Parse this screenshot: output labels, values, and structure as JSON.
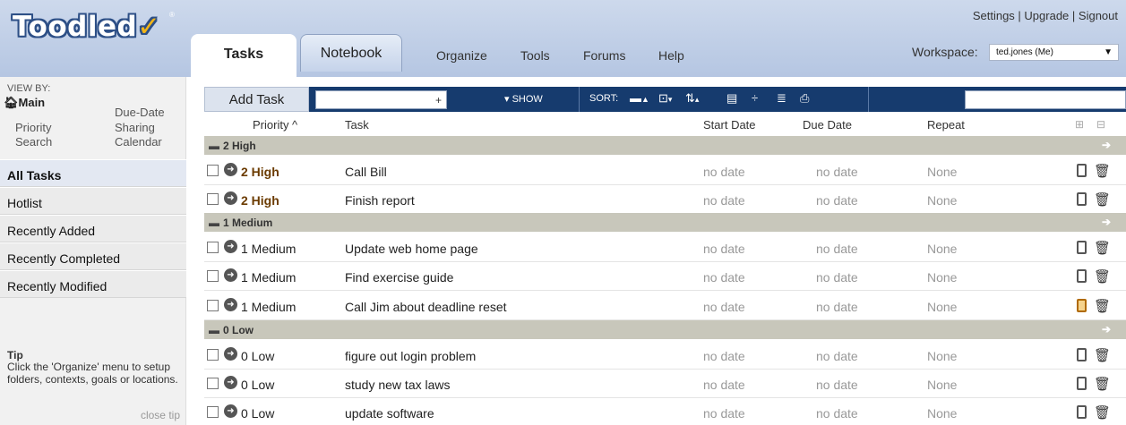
{
  "app": {
    "logo_text": "Toodled",
    "logo_check": "✓",
    "logo_reg": "®"
  },
  "header": {
    "tabs": [
      {
        "label": "Tasks"
      },
      {
        "label": "Notebook"
      }
    ],
    "nav": [
      "Organize",
      "Tools",
      "Forums",
      "Help"
    ],
    "top_links": [
      "Settings",
      "Upgrade",
      "Signout"
    ],
    "workspace_label": "Workspace:",
    "workspace_value": "ted.jones (Me)"
  },
  "sidebar": {
    "viewby_title": "VIEW BY:",
    "viewby": [
      "Main",
      "Due-Date",
      "Priority",
      "Sharing",
      "Search",
      "Calendar"
    ],
    "items": [
      "All Tasks",
      "Hotlist",
      "Recently Added",
      "Recently Completed",
      "Recently Modified"
    ],
    "tip_title": "Tip",
    "tip_text": "Click the 'Organize' menu to setup folders, contexts, goals or locations.",
    "close_tip": "close tip"
  },
  "toolbar": {
    "add_task": "Add Task",
    "add_plus": "+",
    "show": "▾ SHOW",
    "sort": "SORT:"
  },
  "columns": {
    "priority": "Priority ^",
    "task": "Task",
    "start": "Start Date",
    "due": "Due Date",
    "repeat": "Repeat"
  },
  "groups": [
    {
      "label": "2 High",
      "tasks": [
        {
          "priority": "2 High",
          "task": "Call Bill",
          "start": "no date",
          "due": "no date",
          "repeat": "None"
        },
        {
          "priority": "2 High",
          "task": "Finish report",
          "start": "no date",
          "due": "no date",
          "repeat": "None"
        }
      ]
    },
    {
      "label": "1 Medium",
      "tasks": [
        {
          "priority": "1 Medium",
          "task": "Update web home page",
          "start": "no date",
          "due": "no date",
          "repeat": "None"
        },
        {
          "priority": "1 Medium",
          "task": "Find exercise guide",
          "start": "no date",
          "due": "no date",
          "repeat": "None"
        },
        {
          "priority": "1 Medium",
          "task": "Call Jim about deadline reset",
          "start": "no date",
          "due": "no date",
          "repeat": "None"
        }
      ]
    },
    {
      "label": "0 Low",
      "tasks": [
        {
          "priority": "0 Low",
          "task": "figure out login problem",
          "start": "no date",
          "due": "no date",
          "repeat": "None"
        },
        {
          "priority": "0 Low",
          "task": "study new tax laws",
          "start": "no date",
          "due": "no date",
          "repeat": "None"
        },
        {
          "priority": "0 Low",
          "task": "update software",
          "start": "no date",
          "due": "no date",
          "repeat": "None"
        }
      ]
    }
  ],
  "colors": {
    "header_bg": "#b5c6e2",
    "toolbar_bg": "#163b6e",
    "group_bg": "#c8c7bb",
    "logo_outline": "#2d4f86"
  }
}
